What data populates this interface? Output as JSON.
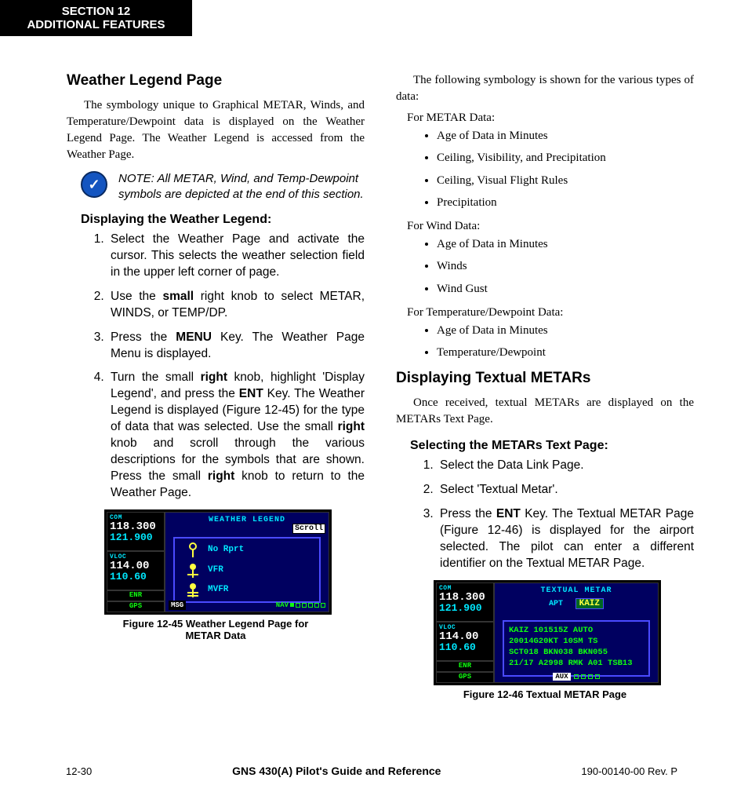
{
  "section_tab": {
    "line1": "SECTION 12",
    "line2": "ADDITIONAL FEATURES"
  },
  "left": {
    "h1": "Weather Legend Page",
    "intro": "The symbology unique to Graphical METAR, Winds, and Temperature/Dewpoint data is displayed on the Weather Legend Page.  The Weather Legend is accessed from the Weather Page.",
    "note": "NOTE:  All METAR, Wind, and Temp-Dewpoint symbols are depicted at the end of this section.",
    "h2": "Displaying the Weather Legend:",
    "steps": [
      {
        "pre": "Select the Weather Page and activate the cursor.  This selects the weather selection field in the upper left corner of page."
      },
      {
        "pre": "Use the ",
        "b1": "small",
        "post1": " right knob to select METAR, WINDS, or TEMP/DP."
      },
      {
        "pre": "Press the ",
        "b1": "MENU",
        "post1": " Key. The Weather Page Menu is displayed."
      },
      {
        "pre": "Turn the small ",
        "b1": "right",
        "post1": " knob, highlight 'Display Legend', and press the ",
        "b2": "ENT",
        "post2": " Key. The Weather Legend is displayed (Figure 12-45) for the type of data that was selected. Use the small ",
        "b3": "right",
        "post3": " knob and scroll through the various descriptions for the symbols that are shown. Press the small ",
        "b4": "right",
        "post4": " knob to return to the Weather Page."
      }
    ],
    "figure": {
      "com_label": "COM",
      "com_big": "118.300",
      "com_sub": "121.900",
      "vloc_label": "VLOC",
      "vloc_big": "114.00",
      "vloc_sub": "110.60",
      "tab_enr": "ENR",
      "tab_gps": "GPS",
      "title": "WEATHER LEGEND",
      "scroll": "Scroll",
      "rows": [
        "No Rprt",
        "VFR",
        "MVFR"
      ],
      "nav_msg": "MSG",
      "nav_label": "NAV",
      "caption": "Figure 12-45  Weather Legend Page for METAR Data"
    }
  },
  "right": {
    "intro": "The following symbology is shown for the various types of data:",
    "groups": [
      {
        "lead": "For METAR Data:",
        "items": [
          "Age of Data in Minutes",
          "Ceiling, Visibility, and Precipitation",
          "Ceiling, Visual Flight Rules",
          "Precipitation"
        ]
      },
      {
        "lead": "For Wind Data:",
        "items": [
          "Age of Data in Minutes",
          "Winds",
          "Wind Gust"
        ]
      },
      {
        "lead": "For Temperature/Dewpoint Data:",
        "items": [
          "Age of Data in Minutes",
          "Temperature/Dewpoint"
        ]
      }
    ],
    "h1": "Displaying Textual METARs",
    "intro2": "Once received, textual METARs are displayed on the METARs Text Page.",
    "h2": "Selecting the METARs Text Page:",
    "steps": [
      {
        "pre": "Select the Data Link Page."
      },
      {
        "pre": "Select 'Textual Metar'."
      },
      {
        "pre": "Press the ",
        "b1": "ENT",
        "post1": " Key.  The Textual METAR Page (Figure 12-46) is displayed for the airport selected.  The pilot can enter a different identifier on the Textual METAR Page."
      }
    ],
    "figure": {
      "com_label": "COM",
      "com_big": "118.300",
      "com_sub": "121.900",
      "vloc_label": "VLOC",
      "vloc_big": "114.00",
      "vloc_sub": "110.60",
      "tab_enr": "ENR",
      "tab_gps": "GPS",
      "title": "TEXTUAL METAR",
      "apt_label": "APT",
      "apt_id": "KAIZ",
      "lines": [
        "KAIZ 101515Z AUTO",
        "20014G20KT 10SM TS",
        "SCT018 BKN038 BKN055",
        "21/17 A2998 RMK A01 TSB13"
      ],
      "aux": "AUX",
      "caption": "Figure 12-46  Textual METAR Page"
    }
  },
  "footer": {
    "page": "12-30",
    "title": "GNS 430(A) Pilot's Guide and Reference",
    "rev": "190-00140-00  Rev. P"
  }
}
